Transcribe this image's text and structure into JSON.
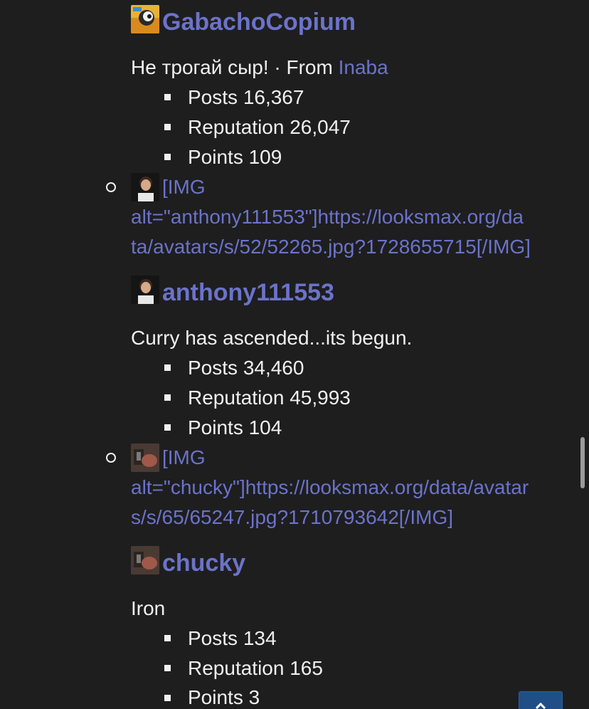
{
  "posts": [
    {
      "username": "GabachoCopium",
      "tagline": "Не трогай сыр!",
      "separator": " · From ",
      "location": "Inaba",
      "stats": [
        {
          "label": "Posts",
          "value": "16,367"
        },
        {
          "label": "Reputation",
          "value": "26,047"
        },
        {
          "label": "Points",
          "value": "109"
        }
      ]
    },
    {
      "img_link_lines": [
        "[IMG",
        "alt=\"anthony111553\"]https://looksmax.org/da",
        "ta/avatars/s/52/52265.jpg?1728655715[/IMG]"
      ],
      "username": "anthony111553",
      "tagline": "Curry has ascended...its begun.",
      "stats": [
        {
          "label": "Posts",
          "value": "34,460"
        },
        {
          "label": "Reputation",
          "value": "45,993"
        },
        {
          "label": "Points",
          "value": "104"
        }
      ]
    },
    {
      "img_link_lines": [
        "[IMG",
        "alt=\"chucky\"]https://looksmax.org/data/avatar",
        "s/s/65/65247.jpg?1710793642[/IMG]"
      ],
      "username": "chucky",
      "tagline": "Iron",
      "stats": [
        {
          "label": "Posts",
          "value": "134"
        },
        {
          "label": "Reputation",
          "value": "165"
        },
        {
          "label": "Points",
          "value": "3"
        }
      ]
    }
  ],
  "icons": {
    "scroll_top": "chevron-up-icon"
  }
}
